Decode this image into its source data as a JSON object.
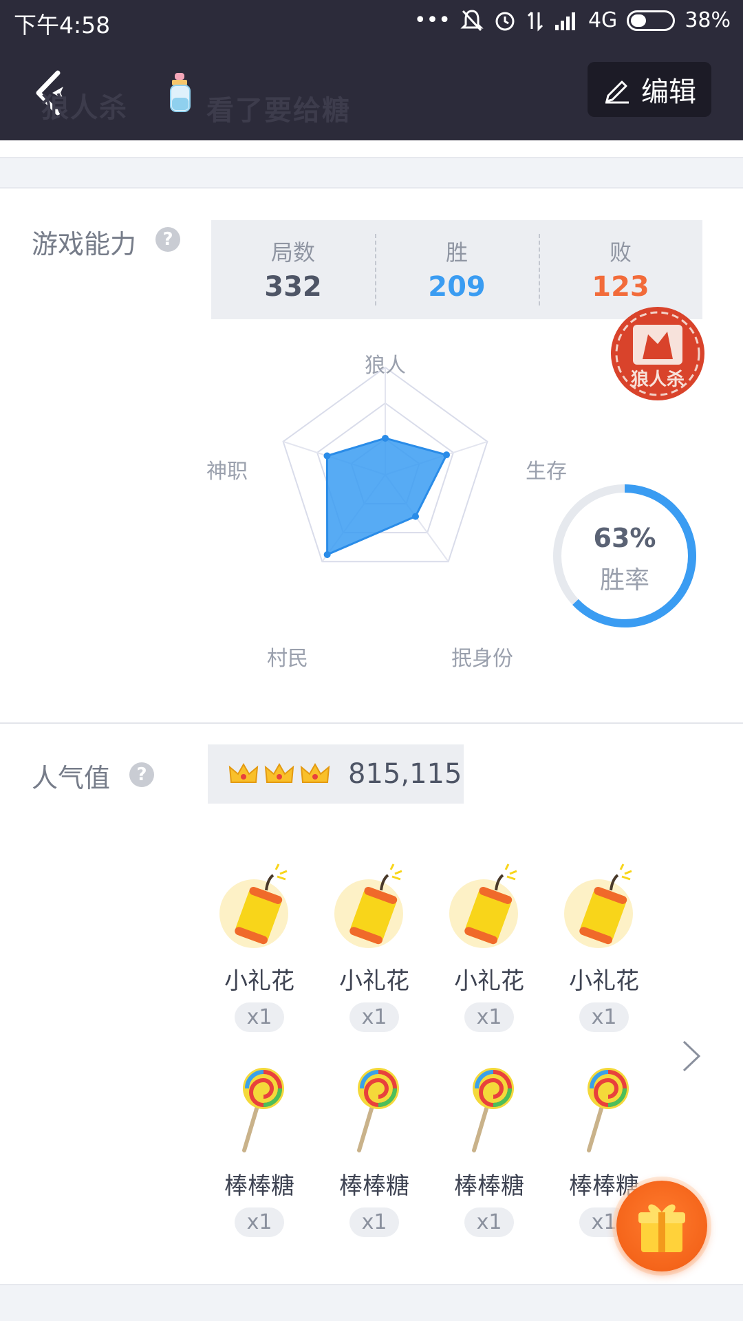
{
  "status_bar": {
    "time": "下午4:58",
    "dots": "•••",
    "network": "4G",
    "battery": "38%",
    "battery_level": 0.38
  },
  "header": {
    "title": "狼人杀",
    "subtitle": "看了要给糖",
    "edit_label": "编辑"
  },
  "ability": {
    "label": "游戏能力",
    "help": "?",
    "stats": [
      {
        "label": "局数",
        "value": "332",
        "color": "#4e5566"
      },
      {
        "label": "胜",
        "value": "209",
        "color": "#3a9cf2"
      },
      {
        "label": "败",
        "value": "123",
        "color": "#f26b3a"
      }
    ],
    "stamp_text": "狼人杀",
    "radar_axes": [
      "狼人",
      "生存",
      "抿身份",
      "村民",
      "神职"
    ],
    "radar_values": [
      0.34,
      0.6,
      0.48,
      0.92,
      0.57
    ],
    "radar_color": "#3a9cf2",
    "winrate": {
      "percent": "63%",
      "label": "胜率",
      "value": 0.63
    }
  },
  "popularity": {
    "label": "人气值",
    "help": "?",
    "crowns": 3,
    "value": "815,115"
  },
  "gifts": [
    {
      "name": "小礼花",
      "count": "x1",
      "icon": "firecracker-icon"
    },
    {
      "name": "小礼花",
      "count": "x1",
      "icon": "firecracker-icon"
    },
    {
      "name": "小礼花",
      "count": "x1",
      "icon": "firecracker-icon"
    },
    {
      "name": "小礼花",
      "count": "x1",
      "icon": "firecracker-icon"
    },
    {
      "name": "棒棒糖",
      "count": "x1",
      "icon": "lollipop-icon"
    },
    {
      "name": "棒棒糖",
      "count": "x1",
      "icon": "lollipop-icon"
    },
    {
      "name": "棒棒糖",
      "count": "x1",
      "icon": "lollipop-icon"
    },
    {
      "name": "棒棒糖",
      "count": "x1",
      "icon": "lollipop-icon"
    }
  ]
}
